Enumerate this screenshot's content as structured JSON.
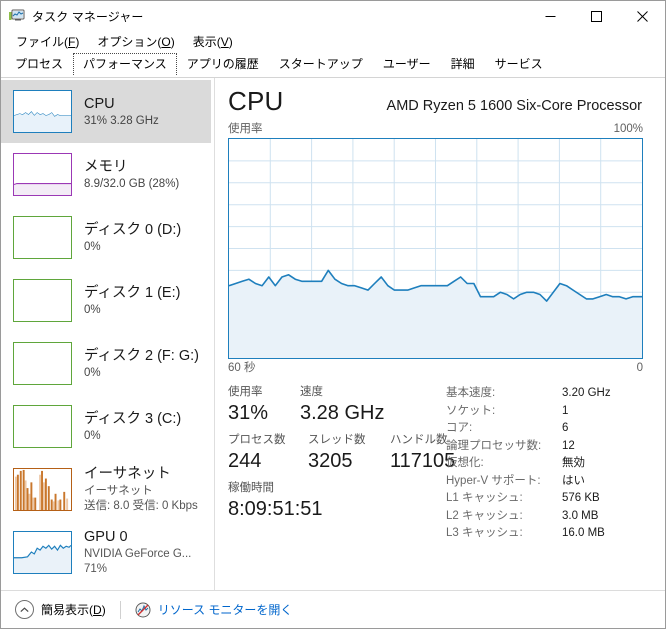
{
  "window": {
    "title": "タスク マネージャー",
    "icon": "task-manager-icon",
    "minimize_label": "最小化",
    "maximize_label": "最大化",
    "close_label": "閉じる"
  },
  "menu": {
    "items": [
      {
        "label": "ファイル",
        "accel": "F"
      },
      {
        "label": "オプション",
        "accel": "O"
      },
      {
        "label": "表示",
        "accel": "V"
      }
    ]
  },
  "tabs": [
    {
      "label": "プロセス",
      "selected": false
    },
    {
      "label": "パフォーマンス",
      "selected": true
    },
    {
      "label": "アプリの履歴",
      "selected": false
    },
    {
      "label": "スタートアップ",
      "selected": false
    },
    {
      "label": "ユーザー",
      "selected": false
    },
    {
      "label": "詳細",
      "selected": false
    },
    {
      "label": "サービス",
      "selected": false
    }
  ],
  "sidebar": {
    "items": [
      {
        "title": "CPU",
        "sub1": "31%  3.28 GHz",
        "sub2": "",
        "selected": true,
        "color": "#1e7fbd",
        "fill": "#e8f2fa"
      },
      {
        "title": "メモリ",
        "sub1": "8.9/32.0 GB (28%)",
        "sub2": "",
        "selected": false,
        "color": "#9b38b5",
        "fill": "#f5edf7"
      },
      {
        "title": "ディスク 0 (D:)",
        "sub1": "0%",
        "sub2": "",
        "selected": false,
        "color": "#5fa63b",
        "fill": "#eef7e9"
      },
      {
        "title": "ディスク 1 (E:)",
        "sub1": "0%",
        "sub2": "",
        "selected": false,
        "color": "#5fa63b",
        "fill": "#eef7e9"
      },
      {
        "title": "ディスク 2 (F: G:)",
        "sub1": "0%",
        "sub2": "",
        "selected": false,
        "color": "#5fa63b",
        "fill": "#eef7e9"
      },
      {
        "title": "ディスク 3 (C:)",
        "sub1": "0%",
        "sub2": "",
        "selected": false,
        "color": "#5fa63b",
        "fill": "#eef7e9"
      },
      {
        "title": "イーサネット",
        "sub1": "イーサネット",
        "sub2": "送信: 8.0 受信: 0 Kbps",
        "selected": false,
        "color": "#b56016",
        "fill": "#fbf0e6"
      },
      {
        "title": "GPU 0",
        "sub1": "NVIDIA GeForce G...",
        "sub2": "71%",
        "selected": false,
        "color": "#1e7fbd",
        "fill": "#eef4fa"
      }
    ]
  },
  "main": {
    "title": "CPU",
    "subtitle": "AMD Ryzen 5 1600 Six-Core Processor",
    "graph_label_left": "使用率",
    "graph_label_right": "100%",
    "graph_foot_left": "60 秒",
    "graph_foot_right": "0",
    "stats": {
      "row1": [
        {
          "label": "使用率",
          "value": "31%"
        },
        {
          "label": "速度",
          "value": "3.28 GHz"
        }
      ],
      "row2": [
        {
          "label": "プロセス数",
          "value": "244"
        },
        {
          "label": "スレッド数",
          "value": "3205"
        },
        {
          "label": "ハンドル数",
          "value": "117105"
        }
      ],
      "row3": [
        {
          "label": "稼働時間",
          "value": "8:09:51:51"
        }
      ]
    },
    "specs": [
      {
        "key": "基本速度:",
        "value": "3.20 GHz"
      },
      {
        "key": "ソケット:",
        "value": "1"
      },
      {
        "key": "コア:",
        "value": "6"
      },
      {
        "key": "論理プロセッサ数:",
        "value": "12"
      },
      {
        "key": "仮想化:",
        "value": "無効"
      },
      {
        "key": "Hyper-V サポート:",
        "value": "はい"
      },
      {
        "key": "L1 キャッシュ:",
        "value": "576 KB"
      },
      {
        "key": "L2 キャッシュ:",
        "value": "3.0 MB"
      },
      {
        "key": "L3 キャッシュ:",
        "value": "16.0 MB"
      }
    ]
  },
  "statusbar": {
    "collapse_label": "簡易表示",
    "collapse_accel": "D",
    "resource_monitor_label": "リソース モニターを開く"
  },
  "colors": {
    "accent_blue": "#1e7fbd",
    "graph_fill": "#e9f2f9",
    "grid_line": "#cfe2f0",
    "selection_gray": "#dadada",
    "link_blue": "#0066cc",
    "memory_purple": "#9b38b5",
    "disk_green": "#5fa63b",
    "ethernet_orange": "#b56016"
  },
  "chart_data": {
    "type": "area",
    "title": "CPU 使用率",
    "ylabel": "使用率",
    "xlabel": "60 秒",
    "ylim": [
      0,
      100
    ],
    "xlim": [
      60,
      0
    ],
    "grid": true,
    "legend": "none",
    "y_axis_top_label": "100%",
    "x_axis_left_label": "60 秒",
    "x_axis_right_label": "0",
    "series": [
      {
        "name": "CPU 使用率",
        "line_color": "#1e7fbd",
        "fill_color": "#e9f2f9",
        "values": [
          33,
          34,
          35,
          36,
          34,
          33,
          37,
          33,
          37,
          38,
          36,
          35,
          35,
          35,
          35,
          40,
          36,
          34,
          33,
          33,
          32,
          31,
          34,
          37,
          33,
          31,
          31,
          31,
          32,
          33,
          33,
          33,
          33,
          33,
          35,
          37,
          34,
          34,
          28,
          28,
          28,
          30,
          29,
          27,
          29,
          30,
          30,
          29,
          26,
          30,
          34,
          33,
          31,
          29,
          27,
          27,
          28,
          29,
          28,
          28,
          27,
          28,
          28
        ]
      }
    ]
  }
}
